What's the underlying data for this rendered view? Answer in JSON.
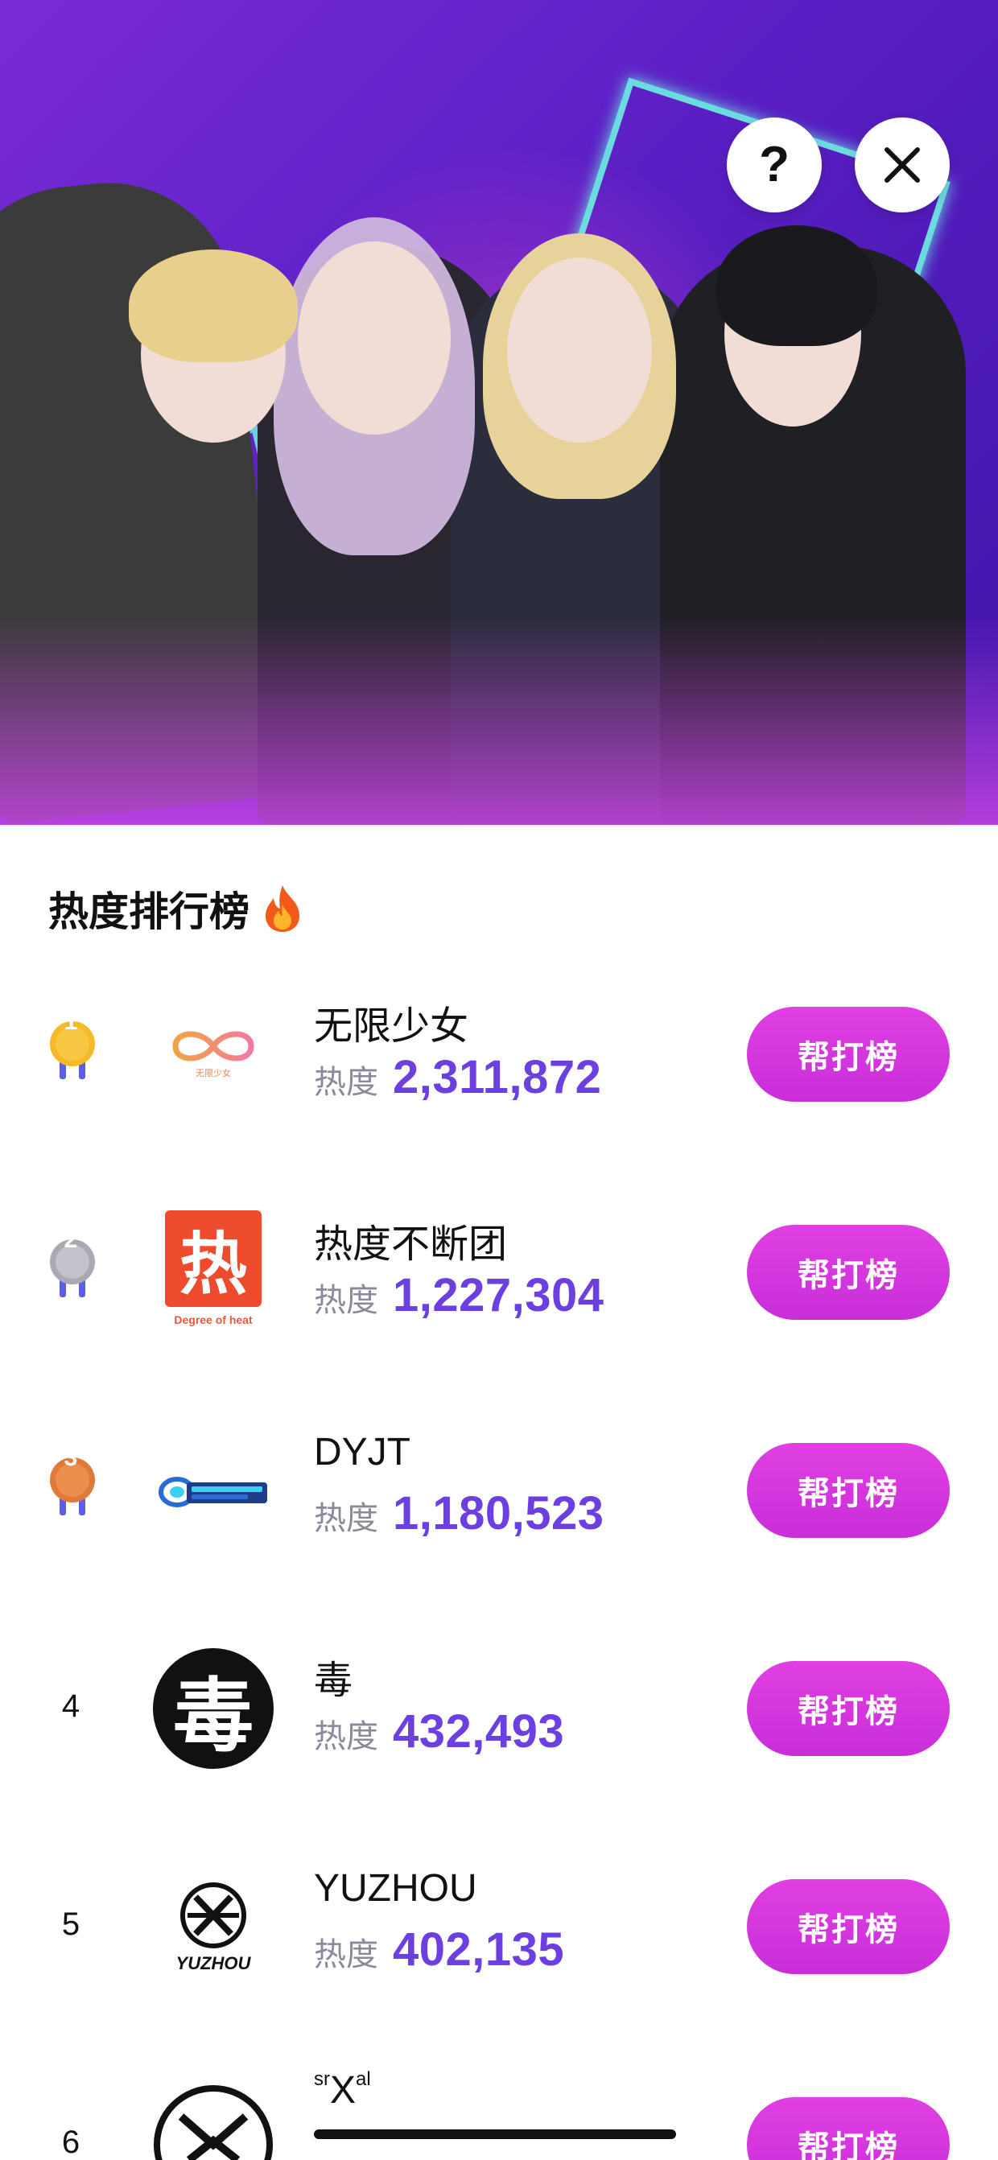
{
  "hero": {
    "help_glyph": "?",
    "close_icon": "close-icon"
  },
  "section": {
    "title": "热度排行榜",
    "title_icon": "flame-icon"
  },
  "heat_label": "热度",
  "boost_label": "帮打榜",
  "rankings": [
    {
      "rank": "1",
      "medal": "gold",
      "name": "无限少女",
      "heat": "2,311,872",
      "logo_caption": "无限少女"
    },
    {
      "rank": "2",
      "medal": "silver",
      "name": "热度不断团",
      "heat": "1,227,304",
      "logo_glyph": "热",
      "logo_caption": "Degree of heat"
    },
    {
      "rank": "3",
      "medal": "bronze",
      "name": "DYJT",
      "heat": "1,180,523"
    },
    {
      "rank": "4",
      "medal": null,
      "name": "毒",
      "heat": "432,493",
      "logo_glyph": "毒"
    },
    {
      "rank": "5",
      "medal": null,
      "name": "YUZHOU",
      "heat": "402,135",
      "logo_caption": "YUZHOU"
    },
    {
      "rank": "6",
      "medal": null,
      "name": "srXal",
      "heat": "",
      "name_prefix": "sr",
      "name_main": "X",
      "name_suffix": "al"
    }
  ],
  "colors": {
    "accent_purple": "#6b3fe0",
    "button_magenta": "#d838e0",
    "hero_purple": "#5a1fc4",
    "neon_cyan": "#6ef0e4"
  }
}
